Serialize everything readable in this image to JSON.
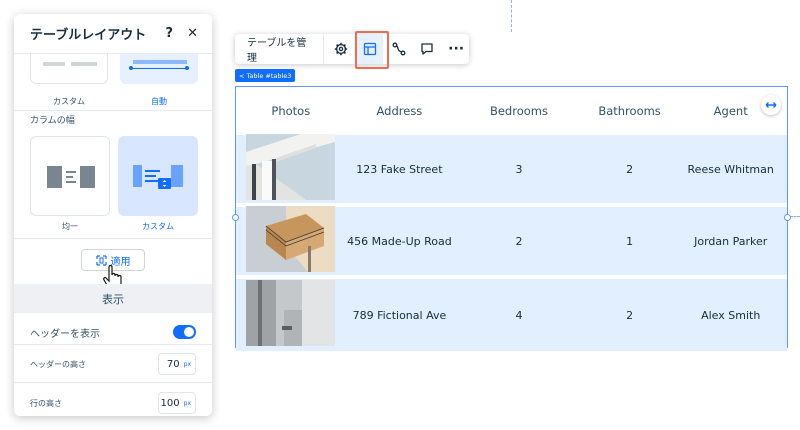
{
  "panel": {
    "title": "テーブルレイアウト",
    "help_icon": "?",
    "close_icon": "✕",
    "layout_options": [
      {
        "label": "カスタム",
        "selected": false
      },
      {
        "label": "自動",
        "selected": true
      }
    ],
    "column_width_label": "カラムの幅",
    "width_options": [
      {
        "label": "均一",
        "selected": false
      },
      {
        "label": "カスタム",
        "selected": true
      }
    ],
    "apply_label": "適用",
    "display_section": "表示",
    "show_header_label": "ヘッダーを表示",
    "show_header_on": true,
    "header_height_label": "ヘッダーの高さ",
    "header_height_value": "70",
    "row_height_label": "行の高さ",
    "row_height_value": "100",
    "unit": "px"
  },
  "toolbar": {
    "manage_label": "テーブルを管理",
    "icons": [
      "gear-icon",
      "layout-icon",
      "connect-icon",
      "comment-icon",
      "more-icon"
    ],
    "more_glyph": "···"
  },
  "table_tag": "< Table #table3",
  "table": {
    "headers": [
      "Photos",
      "Address",
      "Bedrooms",
      "Bathrooms",
      "Agent"
    ],
    "rows": [
      {
        "address": "123 Fake Street",
        "bedrooms": "3",
        "bathrooms": "2",
        "agent": "Reese Whitman"
      },
      {
        "address": "456 Made-Up Road",
        "bedrooms": "2",
        "bathrooms": "1",
        "agent": "Jordan Parker"
      },
      {
        "address": "789 Fictional Ave",
        "bedrooms": "4",
        "bathrooms": "2",
        "agent": "Alex Smith"
      }
    ]
  },
  "colors": {
    "accent": "#116dff",
    "selected_bg": "#e1efff",
    "highlight": "#ef6b53"
  }
}
